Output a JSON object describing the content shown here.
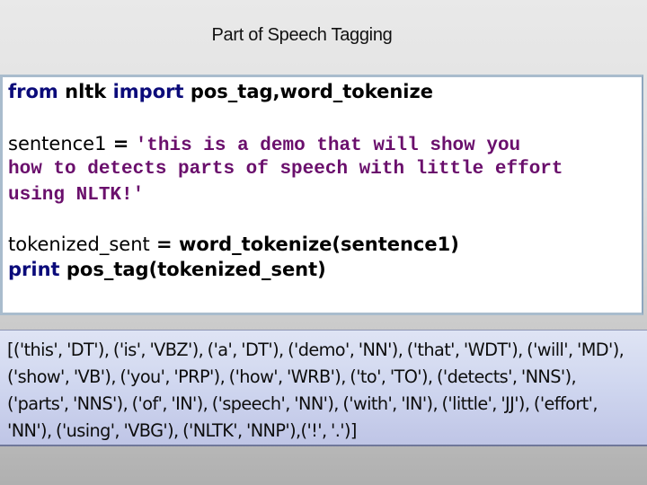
{
  "slide": {
    "title": "Part of Speech Tagging"
  },
  "code": {
    "line1": {
      "kw_from": "from",
      "module": " nltk ",
      "kw_import": "import",
      "names": " pos_tag,word_tokenize"
    },
    "line2": {
      "var": "sentence1",
      "op": " = ",
      "str": "'this is a demo that will show you"
    },
    "line3": {
      "str": "how to detects parts of speech with little effort"
    },
    "line4": {
      "str": "using NLTK!'"
    },
    "line5": {
      "var": "tokenized_sent",
      "op": " = ",
      "call": "word_tokenize(sentence1)"
    },
    "line6": {
      "kw_print": "print",
      "call": " pos_tag(tokenized_sent)"
    }
  },
  "output": {
    "text": "[('this', 'DT'), ('is', 'VBZ'), ('a', 'DT'), ('demo', 'NN'), ('that', 'WDT'), ('will', 'MD'), ('show', 'VB'), ('you', 'PRP'), ('how', 'WRB'), ('to', 'TO'), ('detects', 'NNS'), ('parts', 'NNS'), ('of', 'IN'), ('speech', 'NN'), ('with', 'IN'), ('little', 'JJ'), ('effort', 'NN'), ('using', 'VBG'), ('NLTK', 'NNP'),('!', '.')]"
  },
  "colors": {
    "keyword": "#0b0b7a",
    "string": "#6a0f6c",
    "code_border": "#a9bccd",
    "output_bg": "#cfd6ef"
  }
}
